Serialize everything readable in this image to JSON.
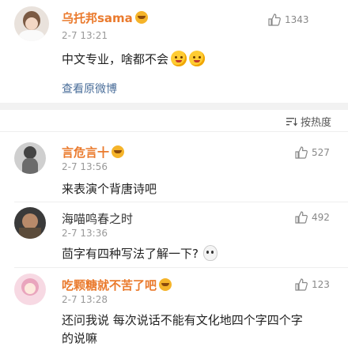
{
  "post": {
    "author": "乌托邦sama",
    "time": "2-7 13:21",
    "likes": "1343",
    "content": "中文专业，啥都不会",
    "view_original": "查看原微博"
  },
  "sort": {
    "label": "按热度"
  },
  "comments": [
    {
      "author": "言危言十",
      "time": "2-7 13:56",
      "likes": "527",
      "text": "来表演个背唐诗吧",
      "author_color": "#ea7a2d"
    },
    {
      "author": "海喵鸣春之时",
      "time": "2-7 13:36",
      "likes": "492",
      "text": "茴字有四种写法了解一下?",
      "author_color": "#333333"
    },
    {
      "author": "吃颗糖就不苦了吧",
      "time": "2-7 13:28",
      "likes": "123",
      "text_line1": "还问我说 每次说话不能有文化地四个字四个字",
      "text_line2": "的说嘛",
      "author_color": "#ea7a2d"
    }
  ],
  "icons": {
    "like": "thumbs-up-icon",
    "sort": "sort-lines-icon",
    "vip": "vip-badge-icon",
    "emoji": "laughing-emoji-icon"
  },
  "colors": {
    "accent": "#ea7a2d",
    "link": "#4a6e9a",
    "muted": "#999999"
  }
}
